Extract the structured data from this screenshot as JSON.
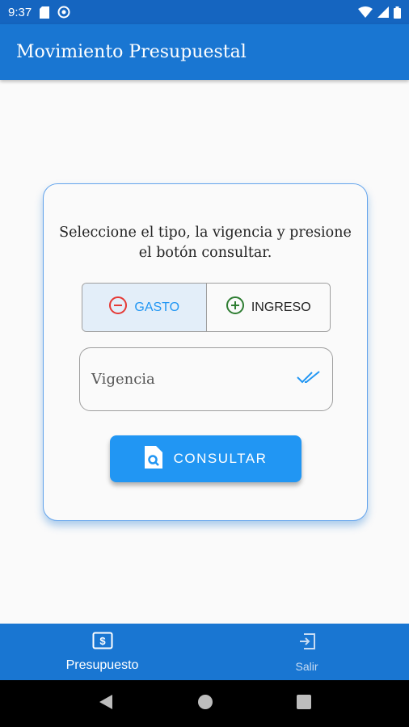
{
  "status_bar": {
    "time": "9:37",
    "icons": [
      "sd-card-icon",
      "sync-icon",
      "wifi-icon",
      "battery-icon"
    ]
  },
  "app_bar": {
    "title": "Movimiento Presupuestal"
  },
  "card": {
    "instructions": "Seleccione el tipo, la vigencia y presione el botón consultar.",
    "toggle": {
      "options": [
        {
          "label": "GASTO",
          "icon": "minus-circle-icon",
          "selected": true,
          "color": "#e53935"
        },
        {
          "label": "INGRESO",
          "icon": "plus-circle-icon",
          "selected": false,
          "color": "#2e7d32"
        }
      ]
    },
    "vigencia": {
      "label": "Vigencia",
      "icon": "double-check-icon"
    },
    "consult_button": {
      "label": "CONSULTAR",
      "icon": "document-search-icon"
    }
  },
  "bottom_nav": {
    "items": [
      {
        "label": "Presupuesto",
        "icon": "money-icon",
        "active": true
      },
      {
        "label": "Salir",
        "icon": "exit-icon",
        "active": false
      }
    ]
  },
  "system_nav": {
    "buttons": [
      "back-icon",
      "home-icon",
      "recents-icon"
    ]
  },
  "colors": {
    "primary": "#1976d2",
    "accent": "#2196f3",
    "status_bar": "#1565c0"
  }
}
